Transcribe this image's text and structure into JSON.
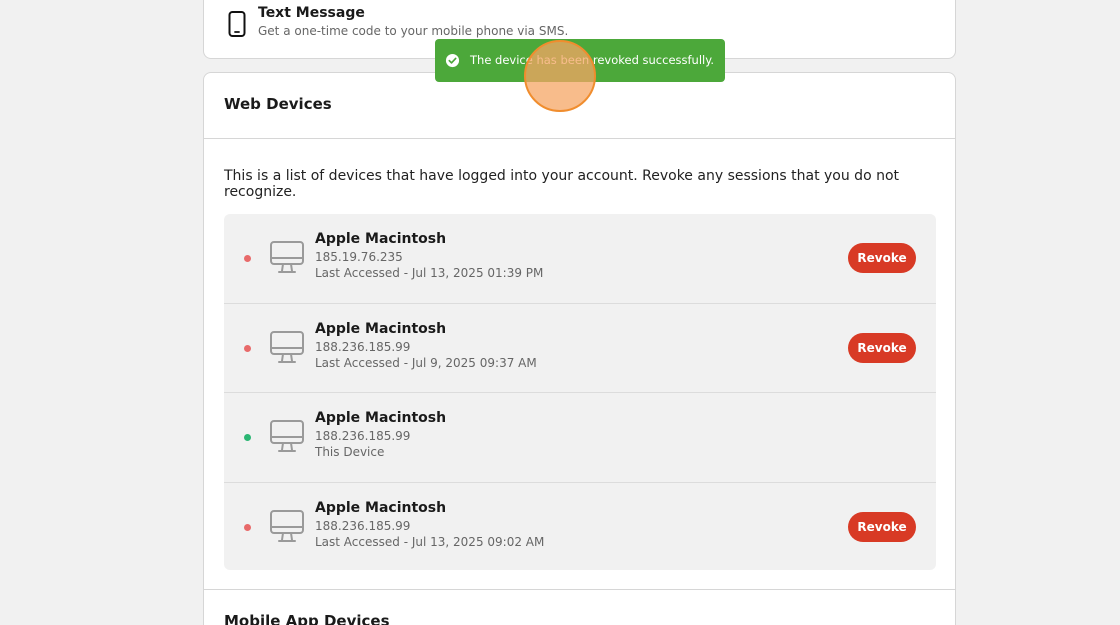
{
  "sms": {
    "title": "Text Message",
    "description": "Get a one-time code to your mobile phone via SMS.",
    "icon": "smartphone-icon"
  },
  "toast": {
    "message": "The device has been revoked successfully.",
    "icon": "check-circle-icon",
    "color": "#4ca83a"
  },
  "web_devices": {
    "title": "Web Devices",
    "description": "This is a list of devices that have logged into your account. Revoke any sessions that you do not recognize.",
    "devices": [
      {
        "name": "Apple Macintosh",
        "ip": "185.19.76.235",
        "access": "Last Accessed - Jul 13, 2025 01:39 PM",
        "status": "inactive",
        "revoke_label": "Revoke"
      },
      {
        "name": "Apple Macintosh",
        "ip": "188.236.185.99",
        "access": "Last Accessed - Jul 9, 2025 09:37 AM",
        "status": "inactive",
        "revoke_label": "Revoke"
      },
      {
        "name": "Apple Macintosh",
        "ip": "188.236.185.99",
        "access": "This Device",
        "status": "active"
      },
      {
        "name": "Apple Macintosh",
        "ip": "188.236.185.99",
        "access": "Last Accessed - Jul 13, 2025 09:02 AM",
        "status": "inactive",
        "revoke_label": "Revoke"
      }
    ]
  },
  "mobile_devices": {
    "title": "Mobile App Devices"
  },
  "colors": {
    "revoke": "#d83a25",
    "dot_inactive": "#e86a6a",
    "dot_active": "#2bb673"
  }
}
